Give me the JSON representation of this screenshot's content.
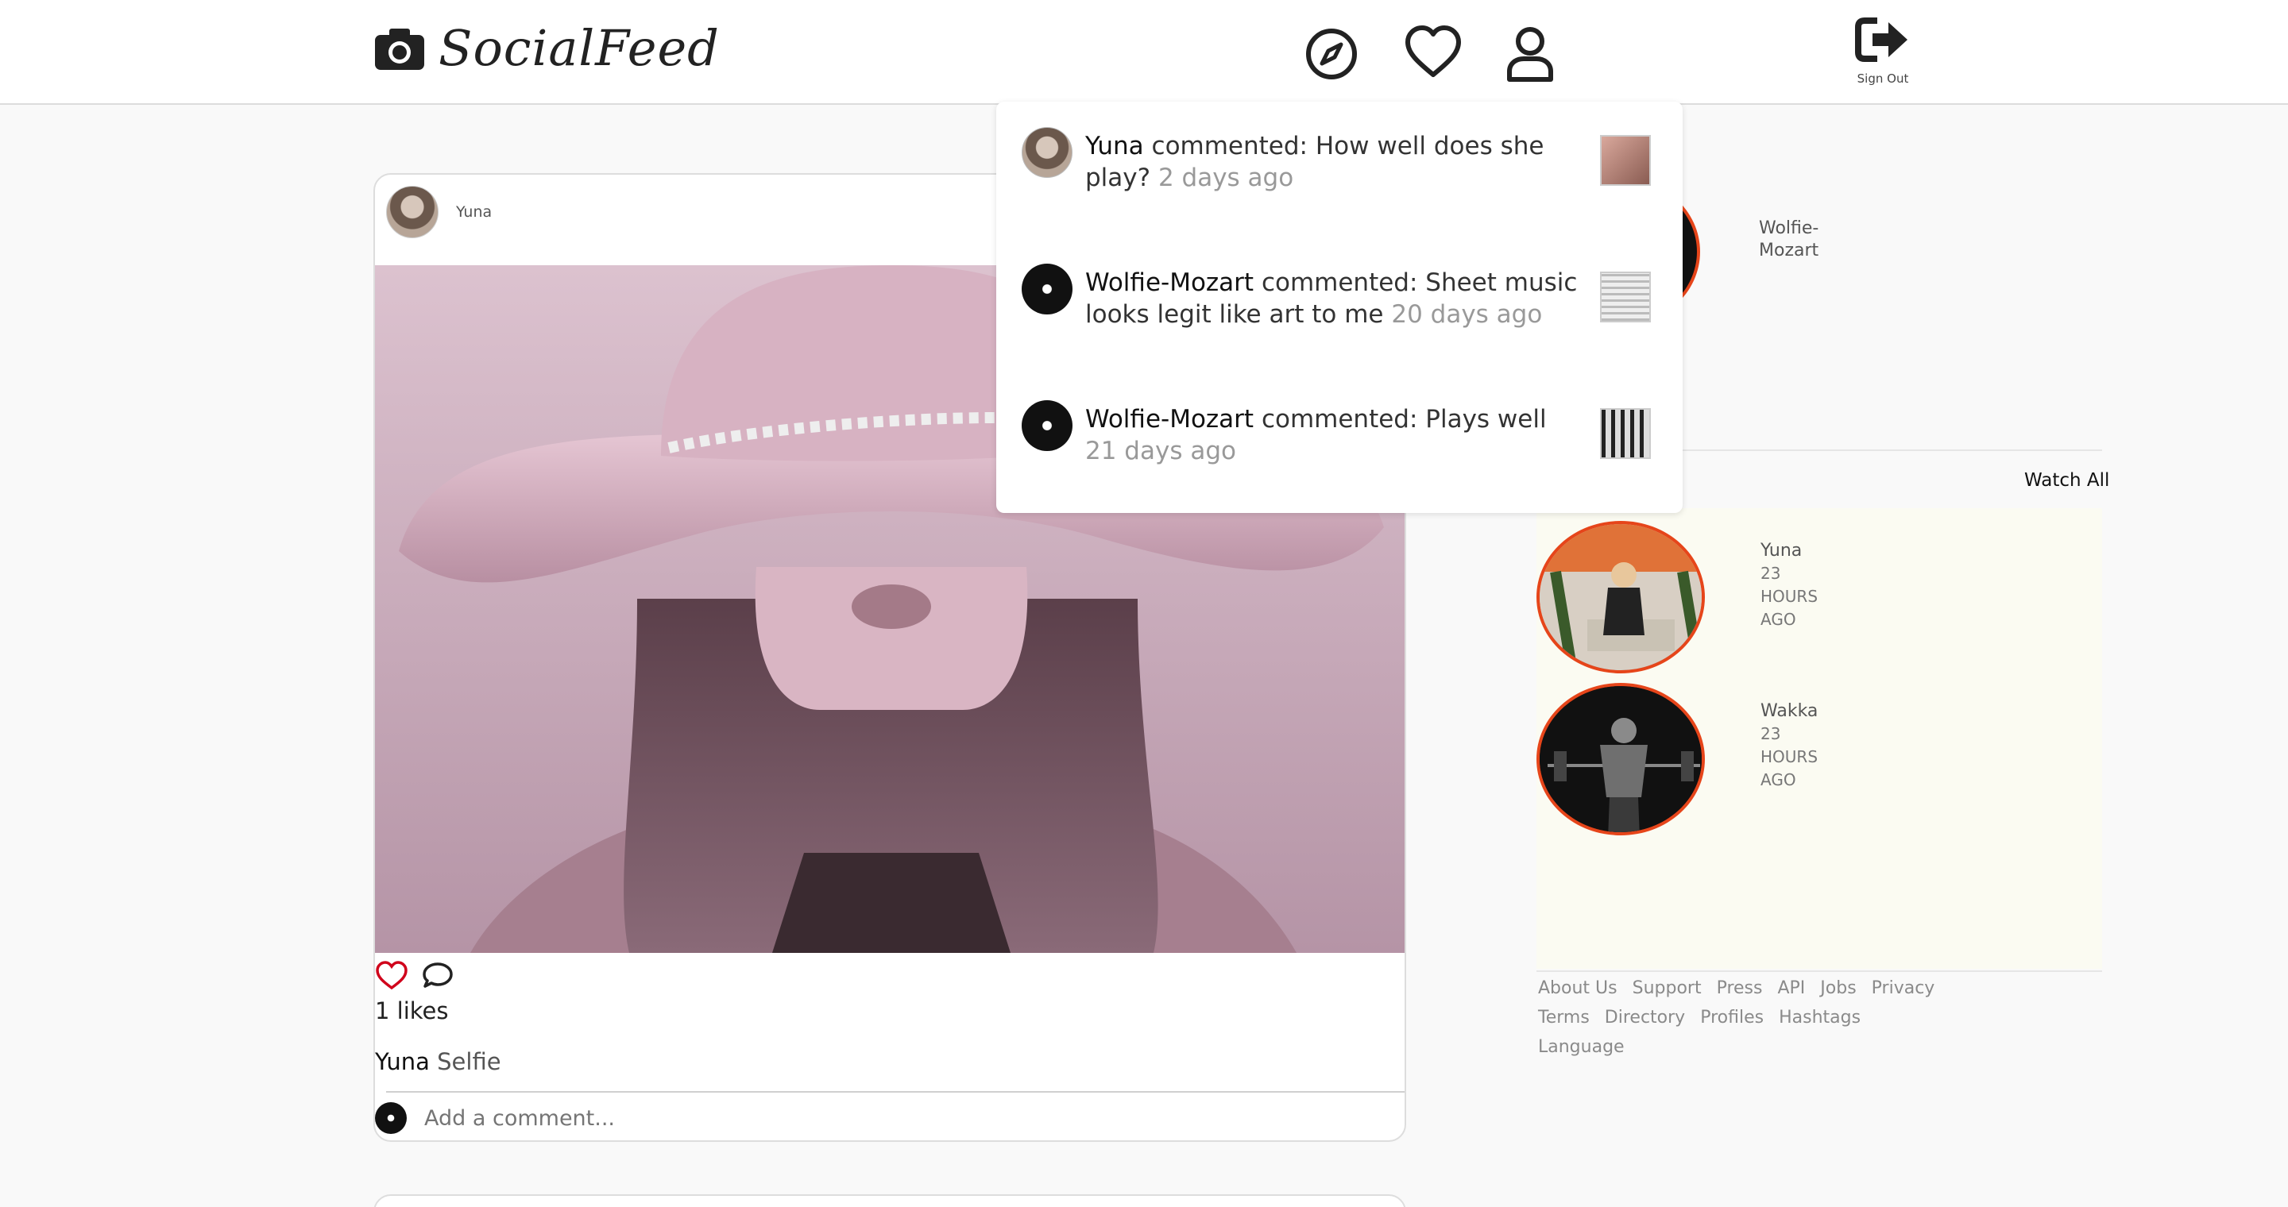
{
  "app": {
    "name": "SocialFeed"
  },
  "header": {
    "nav": [
      {
        "name": "explore-icon"
      },
      {
        "name": "heart-icon"
      },
      {
        "name": "profile-icon"
      }
    ],
    "sign_out_label": "Sign Out"
  },
  "post": {
    "author": "Yuna",
    "likes_text": "1 likes",
    "caption_user": "Yuna",
    "caption_text": "Selfie",
    "comment_placeholder": "Add a comment..."
  },
  "sidebar": {
    "top_story": {
      "name_line1": "Wolfie-",
      "name_line2": "Mozart"
    },
    "watch_all": "Watch All",
    "stories": [
      {
        "name": "Yuna",
        "time_num": "23",
        "time_unit": "HOURS",
        "time_ago": "AGO"
      },
      {
        "name": "Wakka",
        "time_num": "23",
        "time_unit": "HOURS",
        "time_ago": "AGO"
      }
    ],
    "footer_links": [
      "About Us",
      "Support",
      "Press",
      "API",
      "Jobs",
      "Privacy",
      "Terms",
      "Directory",
      "Profiles",
      "Hashtags",
      "Language"
    ]
  },
  "notifications": [
    {
      "user": "Yuna",
      "action": "commented: How well does she play?",
      "time": "2 days ago"
    },
    {
      "user": "Wolfie-Mozart",
      "action": "commented: Sheet music looks legit like art to me",
      "time": "20 days ago"
    },
    {
      "user": "Wolfie-Mozart",
      "action": "commented: Plays well",
      "time": "21 days ago"
    }
  ],
  "colors": {
    "story_ring": "#e6451a",
    "like_heart": "#d0021b"
  }
}
